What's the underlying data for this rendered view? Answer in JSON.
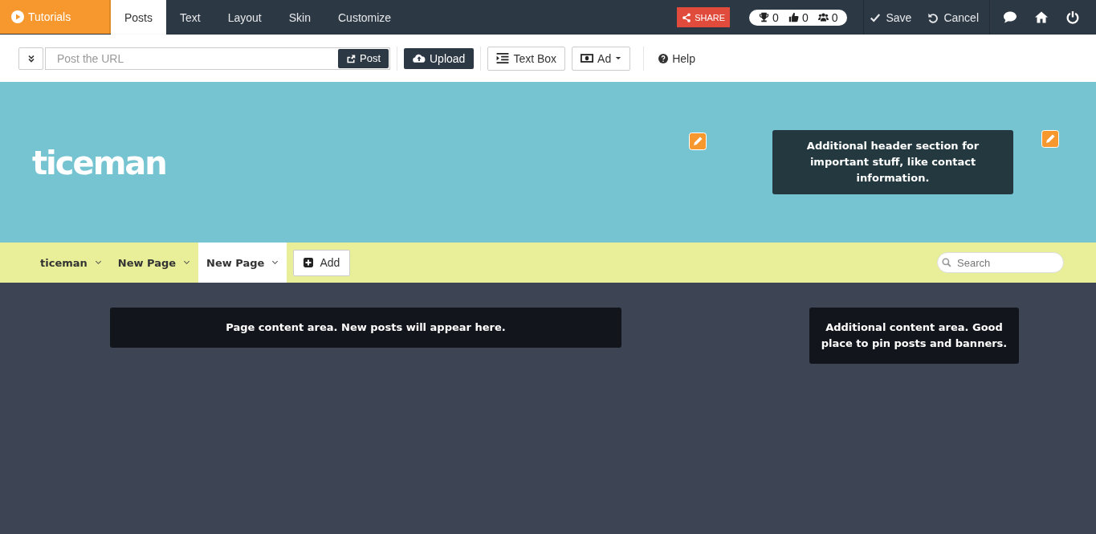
{
  "top_bar": {
    "tutorials": "Tutorials",
    "tabs": [
      {
        "label": "Posts",
        "selected": true
      },
      {
        "label": "Text",
        "selected": false
      },
      {
        "label": "Layout",
        "selected": false
      },
      {
        "label": "Skin",
        "selected": false
      },
      {
        "label": "Customize",
        "selected": false
      }
    ],
    "share": "SHARE",
    "stats": [
      {
        "kind": "trophy",
        "value": "0"
      },
      {
        "kind": "like",
        "value": "0"
      },
      {
        "kind": "users",
        "value": "0"
      }
    ],
    "save": "Save",
    "cancel": "Cancel"
  },
  "toolbar": {
    "url_field": {
      "placeholder": "Post the URL"
    },
    "post": "Post",
    "upload": "Upload",
    "text_box": "Text Box",
    "ad": "Ad",
    "help": "Help"
  },
  "header": {
    "logo": "ticeman",
    "info": "Additional header section for important stuff, like contact information."
  },
  "nav": {
    "items": [
      {
        "label": "ticeman",
        "selected": false
      },
      {
        "label": "New Page",
        "selected": false
      },
      {
        "label": "New Page",
        "selected": true
      }
    ],
    "add": "Add",
    "search": {
      "placeholder": "Search"
    }
  },
  "content": {
    "main": "Page content area. New posts will appear here.",
    "side": "Additional content area. Good place to pin posts and banners."
  }
}
